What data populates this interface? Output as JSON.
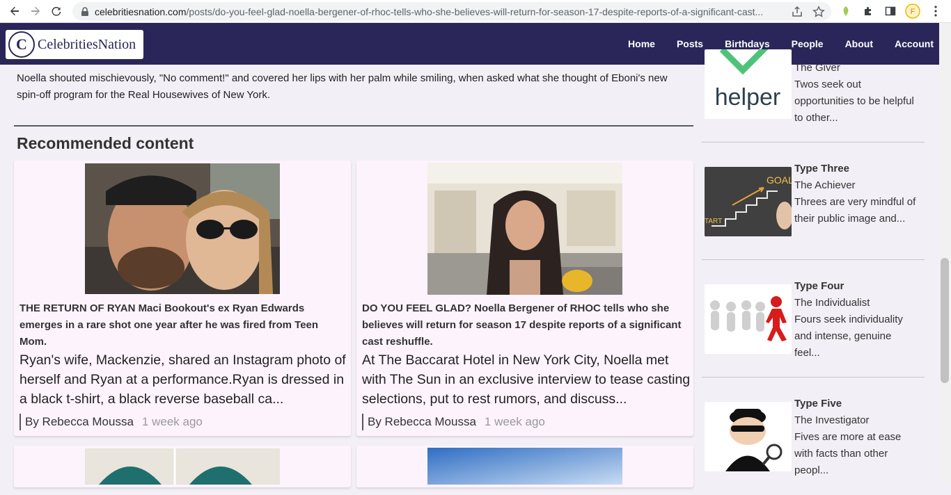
{
  "browser": {
    "url_host": "celebritiesnation.com",
    "url_path": "/posts/do-you-feel-glad-noella-bergener-of-rhoc-tells-who-she-believes-will-return-for-season-17-despite-reports-of-a-significant-cast..."
  },
  "nav": {
    "logo_text": "CelebritiesNation",
    "logo_mark": "C",
    "items": [
      "Home",
      "Posts",
      "Birthdays",
      "People",
      "About",
      "Account"
    ]
  },
  "article": {
    "intro": "Noella shouted mischievously, \"No comment!\" and covered her lips with her palm while smiling, when asked what she thought of Eboni's new spin-off program for the Real Housewives of New York."
  },
  "recommended": {
    "title": "Recommended content",
    "cards": [
      {
        "headline": "THE RETURN OF RYAN Maci Bookout's ex Ryan Edwards emerges in a rare shot one year after he was fired from Teen Mom.",
        "excerpt": "Ryan's wife, Mackenzie, shared an Instagram photo of herself and Ryan at a performance.Ryan is dressed in a black t-shirt, a black reverse baseball ca...",
        "author": "By Rebecca Moussa",
        "ago": "1 week ago"
      },
      {
        "headline": "DO YOU FEEL GLAD? Noella Bergener of RHOC tells who she believes will return for season 17 despite reports of a significant cast reshuffle.",
        "excerpt": "At The Baccarat Hotel in New York City, Noella met with The Sun in an exclusive interview to tease casting selections, put to rest rumors, and discuss...",
        "author": "By Rebecca Moussa",
        "ago": "1 week ago"
      }
    ]
  },
  "sidebar": {
    "items": [
      {
        "type": "",
        "name": "The Giver",
        "desc": "Twos seek out opportunities to be helpful to other...",
        "thumb_text": "helper"
      },
      {
        "type": "Type Three",
        "name": "The Achiever",
        "desc": "Threes are very mindful of their public image and...",
        "thumb_text_goal": "GOAL",
        "thumb_text_start": "TART"
      },
      {
        "type": "Type Four",
        "name": "The Individualist",
        "desc": "Fours seek individuality and intense, genuine feel..."
      },
      {
        "type": "Type Five",
        "name": "The Investigator",
        "desc": "Fives are more at ease with facts than other peopl..."
      }
    ]
  }
}
